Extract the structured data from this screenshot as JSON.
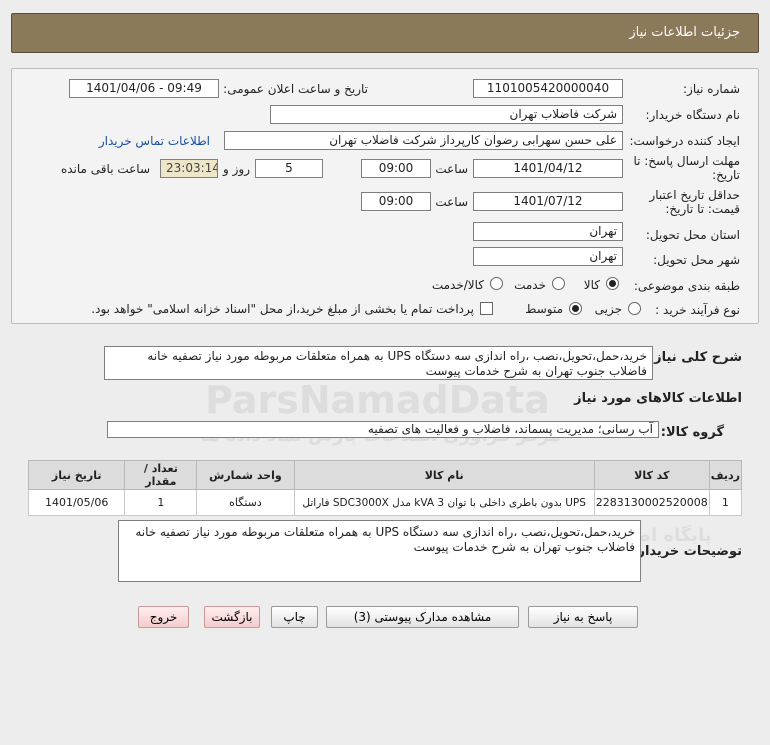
{
  "header": {
    "title": "جزئیات اطلاعات نیاز"
  },
  "fields": {
    "need_number_label": "شماره نیاز:",
    "need_number": "1101005420000040",
    "announce_label": "تاریخ و ساعت اعلان عمومی:",
    "announce_value": "1401/04/06 - 09:49",
    "buyer_org_label": "نام دستگاه خریدار:",
    "buyer_org": "شرکت فاضلاب تهران",
    "creator_label": "ایجاد کننده درخواست:",
    "creator": "علی حسن  سهرابی رضوان کارپرداز شرکت فاضلاب تهران",
    "contact_link": "اطلاعات تماس خریدار",
    "deadline_label_1": "مهلت ارسال پاسخ: تا",
    "deadline_label_2": "تاریخ:",
    "deadline_date": "1401/04/12",
    "time_label": "ساعت",
    "deadline_time": "09:00",
    "days_value": "5",
    "days_label": "روز و",
    "remaining_value": "23:03:14",
    "remaining_label": "ساعت باقی مانده",
    "validity_label_1": "حداقل تاریخ اعتبار",
    "validity_label_2": "قیمت: تا تاریخ:",
    "validity_date": "1401/07/12",
    "validity_time": "09:00",
    "province_label": "استان محل تحویل:",
    "province": "تهران",
    "city_label": "شهر محل تحویل:",
    "city": "تهران",
    "category_label": "طبقه بندی موضوعی:",
    "cat_goods": "کالا",
    "cat_service": "خدمت",
    "cat_both": "کالا/خدمت",
    "process_label": "نوع فرآیند خرید :",
    "proc_partial": "جزیی",
    "proc_medium": "متوسط",
    "payment_note": "پرداخت تمام یا بخشی از مبلغ خرید،از محل \"اسناد خزانه اسلامی\" خواهد بود."
  },
  "summary": {
    "label": "شرح کلی نیاز:",
    "text": "خرید،حمل،تحویل،نصب ،راه اندازی سه دستگاه UPS به همراه متعلقات مربوطه مورد نیاز تصفیه خانه فاضلاب جنوب تهران به شرح خدمات پیوست"
  },
  "goods_section": {
    "title": "اطلاعات کالاهای مورد نیاز",
    "group_label": "گروه کالا:",
    "group_value": "آب رسانی؛ مدیریت پسماند، فاضلاب و فعالیت های تصفیه"
  },
  "table": {
    "headers": [
      "ردیف",
      "کد کالا",
      "نام کالا",
      "واحد شمارش",
      "تعداد / مقدار",
      "تاریخ نیاز"
    ],
    "rows": [
      [
        "1",
        "2283130002520008",
        "UPS بدون باطری داخلی با توان 3 kVA مدل SDC3000X فاراتل",
        "دستگاه",
        "1",
        "1401/05/06"
      ]
    ]
  },
  "buyer_notes": {
    "label": "توضیحات خریدار:",
    "text": "خرید،حمل،تحویل،نصب ،راه اندازی سه دستگاه UPS به همراه متعلقات مربوطه مورد نیاز تصفیه خانه فاضلاب جنوب تهران به شرح خدمات پیوست"
  },
  "buttons": {
    "reply": "پاسخ به نیاز",
    "attachments": "مشاهده مدارک پیوستی (3)",
    "print": "چاپ",
    "back": "بازگشت",
    "exit": "خروج"
  },
  "watermark": {
    "main": "ParsNamadData",
    "sub": "مرکز فراوری اطلاعات پارس نماد داده ها",
    "sub2": "پایگاه اطلاع رسانی مناقصه و مزایده"
  },
  "colors": {
    "header_bg": "#8a7a5a",
    "remaining_bg": "#eee6c8",
    "link": "#1a4fa0",
    "exit_btn": "#f4cccc"
  }
}
